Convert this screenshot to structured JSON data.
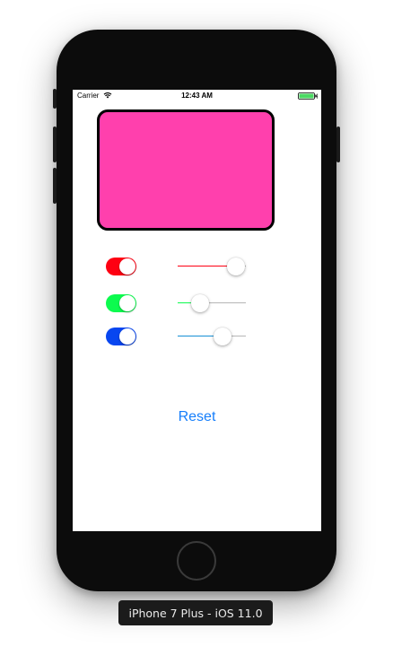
{
  "status_bar": {
    "carrier": "Carrier",
    "time": "12:43 AM",
    "wifi_icon": "wifi-icon",
    "battery_icon": "battery-icon"
  },
  "color_view": {
    "color": "#ff40ad"
  },
  "rows": [
    {
      "switch_on": true,
      "switch_color": "#fe0012",
      "slider_value": 0.85,
      "slider_color": "#fe0012"
    },
    {
      "switch_on": true,
      "switch_color": "#0cfb4e",
      "slider_value": 0.33,
      "slider_color": "#0cfb4e"
    },
    {
      "switch_on": true,
      "switch_color": "#0846f0",
      "slider_value": 0.66,
      "slider_color": "#1690d6"
    }
  ],
  "reset_label": "Reset",
  "device_label": "iPhone 7 Plus - iOS 11.0",
  "accent_color": "#157efb"
}
